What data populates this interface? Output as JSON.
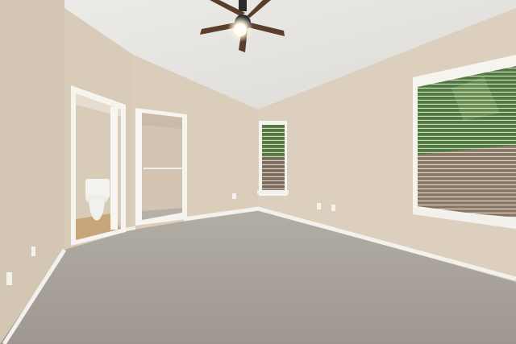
{
  "scene": {
    "subject": "empty-bedroom-photo",
    "colors": {
      "wall_left": "#d6c9b6",
      "wall_back": "#d9ccb9",
      "wall_right": "#dccfbd",
      "ceiling": "#e7e5e1",
      "carpet": "#a8a39c",
      "baseboard": "#f3f1ec",
      "trim": "#f6f4ef",
      "bathroom_floor": "#c9a67a",
      "fan_blade": "#5a3e2b",
      "light_glow": "#fff8e6",
      "foliage": "#4f7a3e",
      "fence": "#8a7763"
    }
  }
}
